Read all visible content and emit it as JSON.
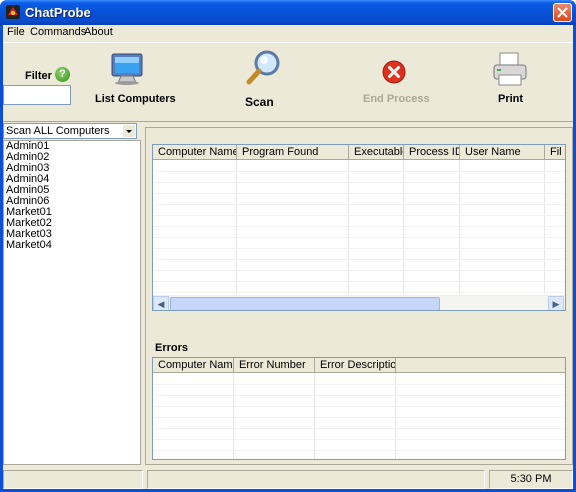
{
  "window": {
    "title": "ChatProbe"
  },
  "menu": {
    "file": "File",
    "commands": "Commands",
    "about": "About"
  },
  "toolbar": {
    "filter_label": "Filter",
    "filter_value": "",
    "list_computers": "List Computers",
    "scan": "Scan",
    "end_process": "End Process",
    "print": "Print"
  },
  "left": {
    "scan_select": "Scan ALL Computers",
    "computers": [
      "Admin01",
      "Admin02",
      "Admin03",
      "Admin04",
      "Admin05",
      "Admin06",
      "Market01",
      "Market02",
      "Market03",
      "Market04"
    ]
  },
  "results": {
    "columns": [
      "Computer Name",
      "Program Found",
      "Executable",
      "Process ID",
      "User Name",
      "Fil"
    ]
  },
  "errors": {
    "label": "Errors",
    "columns": [
      "Computer Name",
      "Error Number",
      "Error Description"
    ]
  },
  "status": {
    "time": "5:30 PM"
  }
}
